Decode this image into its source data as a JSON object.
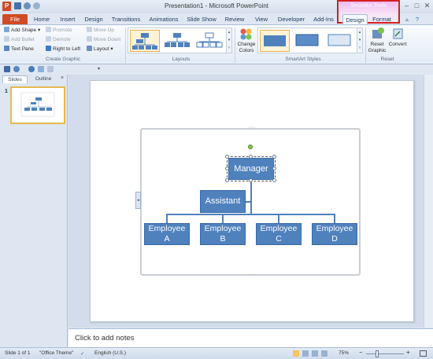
{
  "window": {
    "title": "Presentation1  -  Microsoft PowerPoint",
    "app_icon_letter": "P"
  },
  "contextual_group": {
    "title": "SmartArt Tools"
  },
  "tabs": [
    "File",
    "Home",
    "Insert",
    "Design",
    "Transitions",
    "Animations",
    "Slide Show",
    "Review",
    "View",
    "Developer",
    "Add-Ins",
    "Design",
    "Format"
  ],
  "ribbon": {
    "create_graphic": {
      "label": "Create Graphic",
      "add_shape": "Add Shape",
      "add_bullet": "Add Bullet",
      "text_pane": "Text Pane",
      "promote": "Promote",
      "demote": "Demote",
      "right_to_left": "Right to Left",
      "move_up": "Move Up",
      "move_down": "Move Down",
      "layout": "Layout"
    },
    "layouts": {
      "label": "Layouts"
    },
    "smartart_styles": {
      "label": "SmartArt Styles",
      "change_colors": "Change\nColors"
    },
    "reset": {
      "label": "Reset",
      "reset_graphic": "Reset\nGraphic",
      "convert": "Convert"
    }
  },
  "slide_pane": {
    "tabs": [
      "Slides",
      "Outline"
    ],
    "close": "×",
    "slide_number": "1"
  },
  "smartart": {
    "nodes": {
      "manager": "Manager",
      "assistant": "Assistant",
      "employee_a": "Employee\nA",
      "employee_b": "Employee\nB",
      "employee_c": "Employee\nC",
      "employee_d": "Employee\nD"
    }
  },
  "notes": {
    "placeholder": "Click to add notes"
  },
  "status": {
    "slide": "Slide 1 of 1",
    "theme": "\"Office Theme\"",
    "language": "English (U.S.)",
    "zoom": "75%",
    "zoom_minus": "−",
    "zoom_plus": "+"
  },
  "colors": {
    "node_fill": "#4f81bd",
    "file_tab": "#d04b23",
    "highlight_box": "#d41e1e",
    "contextual_tab_tint": "#f1b9ef",
    "selected_thumb": "#e5b94f"
  },
  "icons": [
    "powerpoint-app-icon",
    "save-icon",
    "undo-icon",
    "redo-icon",
    "minimize-icon",
    "restore-icon",
    "close-icon",
    "help-icon",
    "text-pane-toggle-icon"
  ]
}
